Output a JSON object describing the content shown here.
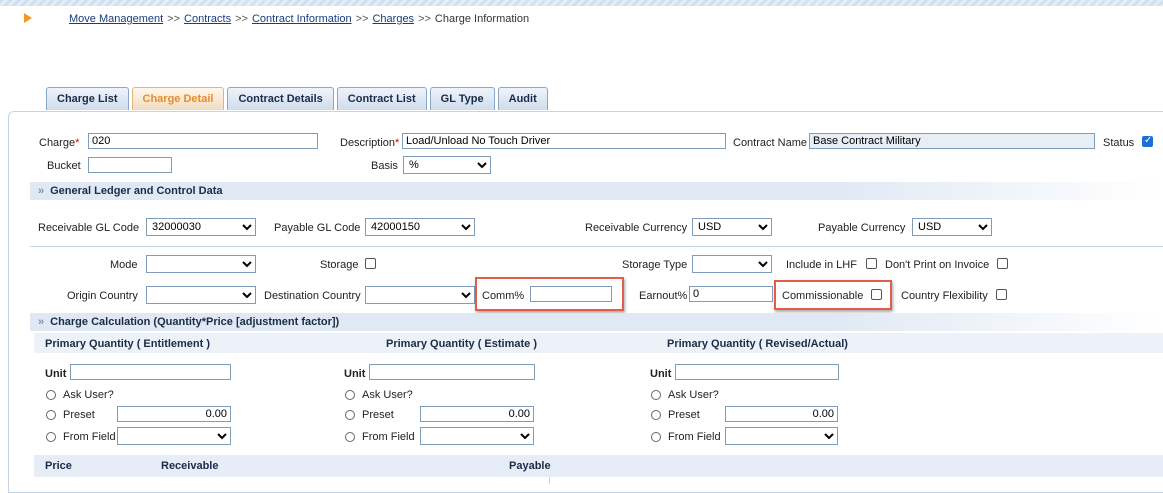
{
  "breadcrumb": {
    "links": [
      "Move Management",
      "Contracts",
      "Contract Information",
      "Charges"
    ],
    "separator": ">>",
    "current": "Charge Information"
  },
  "tabs": [
    "Charge List",
    "Charge Detail",
    "Contract Details",
    "Contract List",
    "GL Type",
    "Audit"
  ],
  "active_tab": "Charge Detail",
  "header": {
    "charge_label": "Charge",
    "charge_value": "020",
    "required_mark": "*",
    "description_label": "Description",
    "description_value": "Load/Unload No Touch Driver",
    "contract_name_label": "Contract Name",
    "contract_name_value": "Base Contract Military",
    "status_label": "Status",
    "status_checked": true,
    "bucket_label": "Bucket",
    "bucket_value": "",
    "basis_label": "Basis",
    "basis_value": "%"
  },
  "gl_section": {
    "title": "General Ledger and Control Data",
    "receivable_gl_label": "Receivable GL Code",
    "receivable_gl_value": "32000030",
    "payable_gl_label": "Payable GL Code",
    "payable_gl_value": "42000150",
    "receivable_currency_label": "Receivable Currency",
    "receivable_currency_value": "USD",
    "payable_currency_label": "Payable Currency",
    "payable_currency_value": "USD",
    "mode_label": "Mode",
    "storage_label": "Storage",
    "storage_type_label": "Storage Type",
    "include_lhf_label": "Include in LHF",
    "dont_print_label": "Don't Print on Invoice",
    "origin_country_label": "Origin Country",
    "destination_country_label": "Destination Country",
    "comm_label": "Comm%",
    "comm_value": "",
    "earnout_label": "Earnout%",
    "earnout_value": "0",
    "commissionable_label": "Commissionable",
    "country_flex_label": "Country Flexibility"
  },
  "calc_section": {
    "title": "Charge Calculation (Quantity*Price [adjustment factor])",
    "columns": [
      {
        "heading": "Primary Quantity  ( Entitlement )",
        "unit_label": "Unit",
        "ask_user": "Ask User?",
        "preset": "Preset",
        "preset_value": "0.00",
        "from_field": "From Field"
      },
      {
        "heading": "Primary Quantity  ( Estimate )",
        "unit_label": "Unit",
        "ask_user": "Ask User?",
        "preset": "Preset",
        "preset_value": "0.00",
        "from_field": "From Field"
      },
      {
        "heading": "Primary Quantity  ( Revised/Actual)",
        "unit_label": "Unit",
        "ask_user": "Ask User?",
        "preset": "Preset",
        "preset_value": "0.00",
        "from_field": "From Field"
      }
    ]
  },
  "price_table": {
    "price_label": "Price",
    "receivable_label": "Receivable",
    "payable_label": "Payable"
  },
  "colors": {
    "highlight_border": "#e25b4b",
    "active_tab_text": "#e58d2e",
    "link": "#1a3d7c"
  }
}
